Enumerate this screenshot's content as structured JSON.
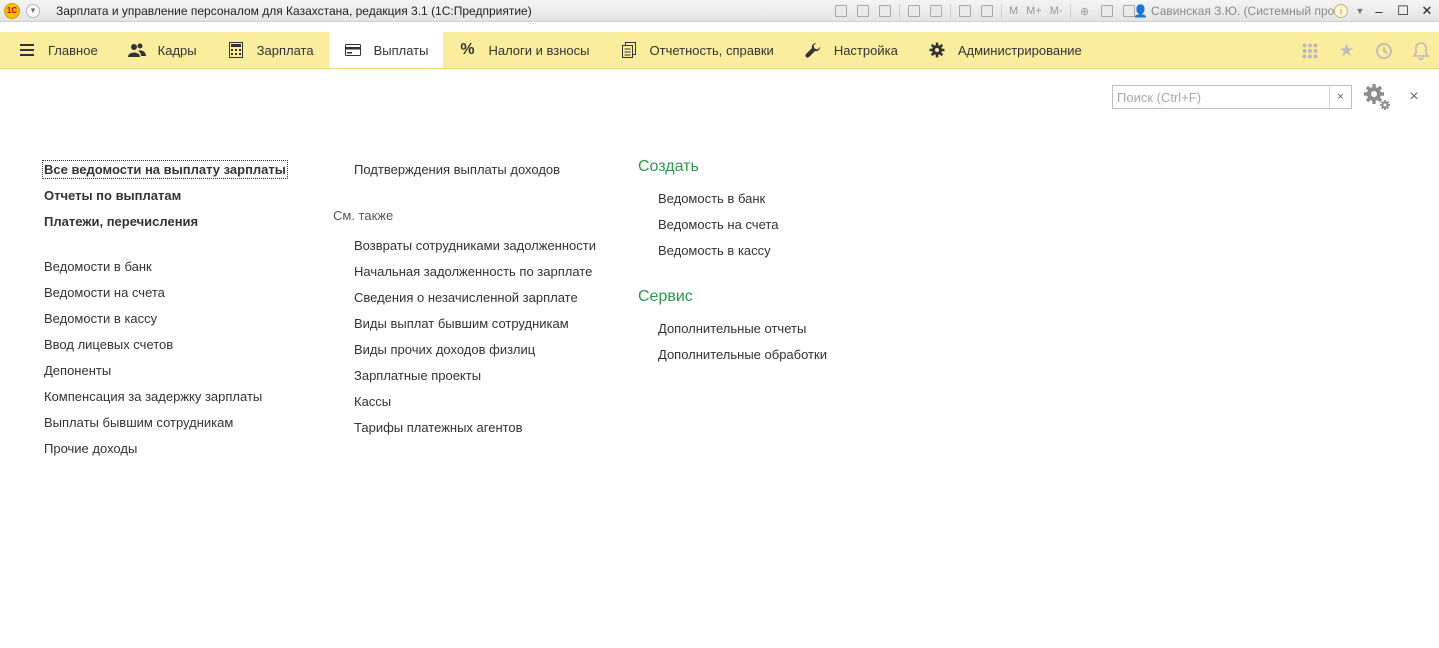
{
  "window": {
    "app_badge": "1С",
    "title": "Зарплата и управление персоналом для Казахстана, редакция 3.1  (1С:Предприятие)",
    "user": "Савинская З.Ю. (Системный прог...",
    "toolbar_text": {
      "m": "M",
      "mplus": "M+",
      "mminus": "M-"
    }
  },
  "sections": [
    {
      "label": "Главное",
      "icon": "menu-icon"
    },
    {
      "label": "Кадры",
      "icon": "people-icon"
    },
    {
      "label": "Зарплата",
      "icon": "calculator-icon"
    },
    {
      "label": "Выплаты",
      "icon": "card-icon",
      "active": true
    },
    {
      "label": "Налоги и взносы",
      "icon": "percent-icon"
    },
    {
      "label": "Отчетность, справки",
      "icon": "documents-icon"
    },
    {
      "label": "Настройка",
      "icon": "wrench-icon"
    },
    {
      "label": "Администрирование",
      "icon": "gear-icon"
    }
  ],
  "search": {
    "placeholder": "Поиск (Ctrl+F)",
    "value": "",
    "clear": "×"
  },
  "panel_close": "×",
  "column1": {
    "bold_links": [
      "Все ведомости на выплату зарплаты",
      "Отчеты по выплатам",
      "Платежи, перечисления"
    ],
    "links": [
      "Ведомости в банк",
      "Ведомости на счета",
      "Ведомости в кассу",
      "Ввод лицевых счетов",
      "Депоненты",
      "Компенсация за задержку зарплаты",
      "Выплаты бывшим сотрудникам",
      "Прочие доходы"
    ]
  },
  "column2": {
    "top_links": [
      "Подтверждения выплаты доходов"
    ],
    "see_also_header": "См. также",
    "see_also_links": [
      "Возвраты сотрудниками задолженности",
      "Начальная задолженность по зарплате",
      "Сведения о незачисленной зарплате",
      "Виды выплат бывшим сотрудникам",
      "Виды прочих доходов физлиц",
      "Зарплатные проекты",
      "Кассы",
      "Тарифы платежных агентов"
    ]
  },
  "column3": {
    "create_header": "Создать",
    "create_links": [
      "Ведомость в банк",
      "Ведомость на счета",
      "Ведомость в кассу"
    ],
    "service_header": "Сервис",
    "service_links": [
      "Дополнительные отчеты",
      "Дополнительные обработки"
    ]
  },
  "colors": {
    "section_bg": "#fbed9e",
    "group_header": "#2a9a49"
  }
}
